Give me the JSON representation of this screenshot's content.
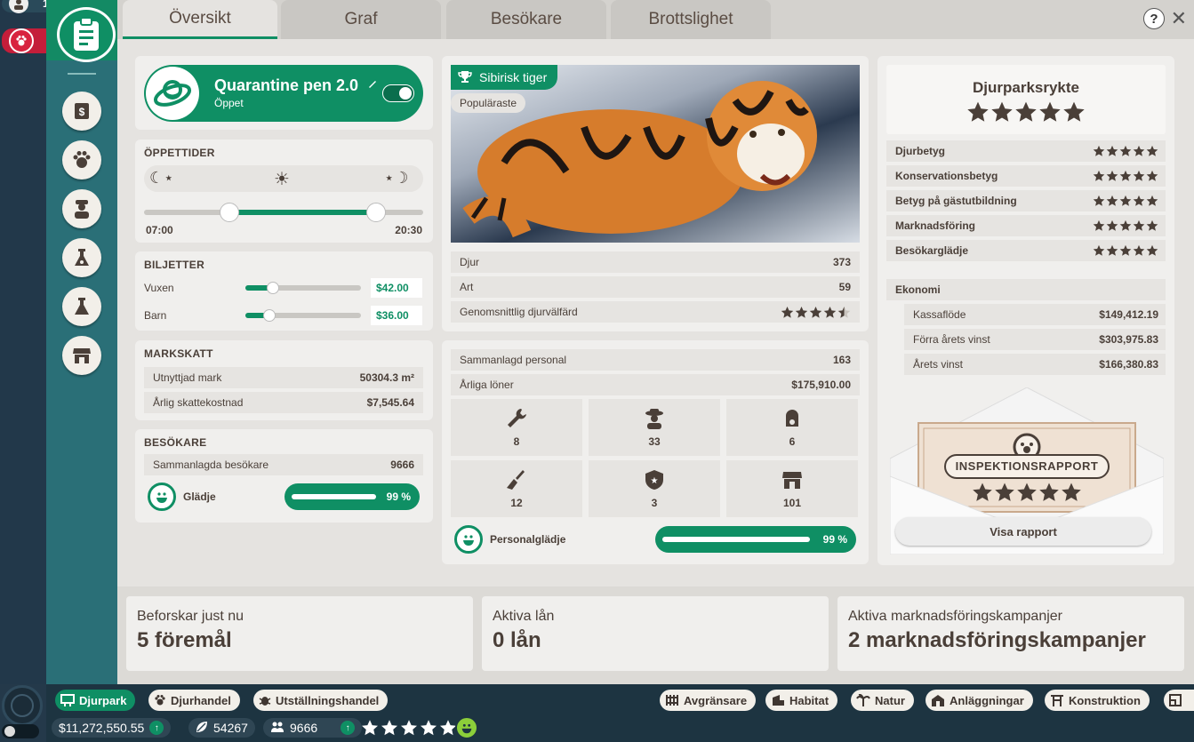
{
  "top_badges": {
    "guests_count": "10",
    "alerts_count": "1"
  },
  "tabs": [
    {
      "label": "Översikt"
    },
    {
      "label": "Graf"
    },
    {
      "label": "Besökare"
    },
    {
      "label": "Brottslighet"
    }
  ],
  "help_label": "?",
  "close_label": "✕",
  "habitat": {
    "name": "Quarantine pen 2.0",
    "status": "Öppet",
    "open_toggle": true
  },
  "opening_hours": {
    "title": "ÖPPETTIDER",
    "open_time": "07:00",
    "close_time": "20:30"
  },
  "tickets": {
    "title": "BILJETTER",
    "adult_label": "Vuxen",
    "adult_price": "$42.00",
    "child_label": "Barn",
    "child_price": "$36.00"
  },
  "land_tax": {
    "title": "MARKSKATT",
    "used_label": "Utnyttjad mark",
    "used_value": "50304.3 m²",
    "annual_label": "Årlig skattekostnad",
    "annual_value": "$7,545.64"
  },
  "visitors": {
    "title": "BESÖKARE",
    "total_label": "Sammanlagda besökare",
    "total_value": "9666",
    "happiness_label": "Glädje",
    "happiness_pct": "99 %",
    "happiness_value": 0.99
  },
  "featured": {
    "species": "Sibirisk tiger",
    "tag": "Populäraste"
  },
  "animals": {
    "animals_label": "Djur",
    "animals_value": "373",
    "species_label": "Art",
    "species_value": "59",
    "welfare_label": "Genomsnittlig djurvälfärd",
    "welfare_rating": 4.5
  },
  "staff": {
    "total_label": "Sammanlagd personal",
    "total_value": "163",
    "salary_label": "Årliga löner",
    "salary_value": "$175,910.00",
    "counts": [
      {
        "icon": "wrench-icon",
        "value": "8"
      },
      {
        "icon": "zookeeper-icon",
        "value": "33"
      },
      {
        "icon": "vet-icon",
        "value": "6"
      },
      {
        "icon": "broom-icon",
        "value": "12"
      },
      {
        "icon": "security-badge-icon",
        "value": "3"
      },
      {
        "icon": "shop-icon",
        "value": "101"
      }
    ],
    "happiness_label": "Personalglädje",
    "happiness_pct": "99 %",
    "happiness_value": 0.99
  },
  "reputation": {
    "title": "Djurparksrykte",
    "rating": 5,
    "rows": [
      {
        "label": "Djurbetyg",
        "rating": 5
      },
      {
        "label": "Konservationsbetyg",
        "rating": 5
      },
      {
        "label": "Betyg på gästutbildning",
        "rating": 5
      },
      {
        "label": "Marknadsföring",
        "rating": 5
      },
      {
        "label": "Besökarglädje",
        "rating": 5
      }
    ]
  },
  "economy": {
    "title": "Ekonomi",
    "rows": [
      {
        "label": "Kassaflöde",
        "value": "$149,412.19"
      },
      {
        "label": "Förra årets vinst",
        "value": "$303,975.83"
      },
      {
        "label": "Årets vinst",
        "value": "$166,380.83"
      }
    ]
  },
  "inspection": {
    "title": "INSPEKTIONSRAPPORT",
    "rating": 5,
    "button": "Visa rapport"
  },
  "bottom_cards": [
    {
      "title": "Beforskar just nu",
      "value": "5 föremål"
    },
    {
      "title": "Aktiva lån",
      "value": "0 lån"
    },
    {
      "title": "Aktiva marknadsföringskampanjer",
      "value": "2 marknadsföringskampanjer"
    }
  ],
  "bottom_tabs_left": [
    {
      "label": "Djurpark",
      "active": true
    },
    {
      "label": "Djurhandel"
    },
    {
      "label": "Utställningshandel"
    }
  ],
  "bottom_tabs_right": [
    {
      "label": "Avgränsare"
    },
    {
      "label": "Habitat"
    },
    {
      "label": "Natur"
    },
    {
      "label": "Anläggningar"
    },
    {
      "label": "Konstruktion"
    }
  ],
  "status_bar": {
    "money": "$11,272,550.55",
    "conservation": "54267",
    "guests": "9666",
    "park_rating": 5
  },
  "colors": {
    "accent": "#0f8f64",
    "panel": "#e5e3e0",
    "dark": "#1d3441",
    "star": "#4a3f38"
  }
}
